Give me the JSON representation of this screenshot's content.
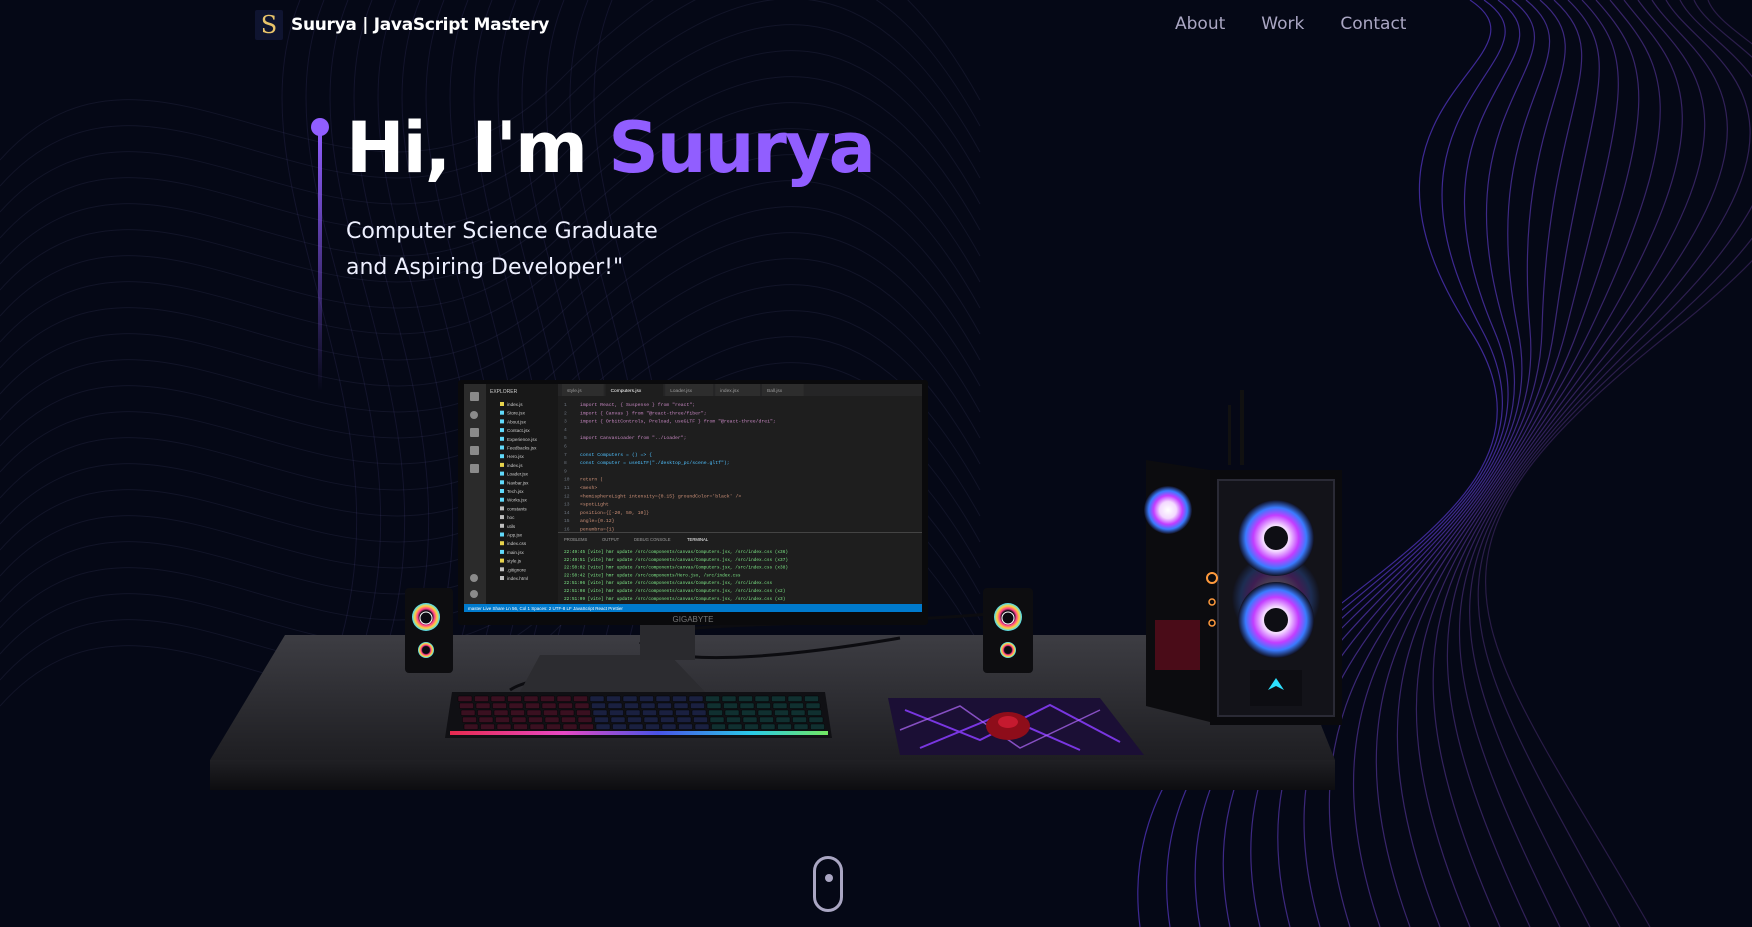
{
  "nav": {
    "logo_letter": "S",
    "brand_text": "Suurya  | JavaScript Mastery",
    "links": [
      "About",
      "Work",
      "Contact"
    ]
  },
  "hero": {
    "greeting": "Hi, I'm ",
    "name": "Suurya",
    "subtitle_line1": "Computer Science Graduate",
    "subtitle_line2": "and Aspiring Developer!\""
  },
  "monitor": {
    "brand": "GIGABYTE",
    "explorer_header": "EXPLORER",
    "tabs": [
      "style.js",
      "Computers.jsx",
      "Loader.jsx",
      "index.jsx",
      "Ball.jsx"
    ],
    "code_lines": [
      "import React, { Suspense } from \"react\";",
      "import { Canvas } from \"@react-three/fiber\";",
      "import { OrbitControls, Preload, useGLTF } from \"@react-three/drei\";",
      "",
      "import CanvasLoader from \"../Loader\";",
      "",
      "const Computers = () => {",
      "  const computer = useGLTF(\"./desktop_pc/scene.gltf\");",
      "",
      "  return (",
      "    <mesh>",
      "      <hemisphereLight intensity={0.15} groundColor='black' />",
      "      <spotLight",
      "        position={[-20, 50, 10]}",
      "        angle={0.12}",
      "        penumbra={1}"
    ],
    "files": [
      "index.js",
      "Store.jsx",
      "About.jsx",
      "Contact.jsx",
      "Experience.jsx",
      "Feedbacks.jsx",
      "Hero.jsx",
      "index.js",
      "Loader.jsx",
      "Navbar.jsx",
      "Tech.jsx",
      "Works.jsx",
      "constants",
      "hoc",
      "utils",
      "App.jsx",
      "index.css",
      "main.jsx",
      "style.js",
      ".gitignore",
      "index.html"
    ],
    "panel_tabs": [
      "PROBLEMS",
      "OUTPUT",
      "DEBUG CONSOLE",
      "TERMINAL"
    ],
    "terminal_lines": [
      "22:49:45 [vite] hmr update /src/components/canvas/Computers.jsx, /src/index.css (x36)",
      "22:49:51 [vite] hmr update /src/components/canvas/Computers.jsx, /src/index.css (x37)",
      "22:50:02 [vite] hmr update /src/components/canvas/Computers.jsx, /src/index.css (x38)",
      "22:50:42 [vite] hmr update /src/components/Hero.jsx, /src/index.css",
      "22:51:06 [vite] hmr update /src/components/canvas/Computers.jsx, /src/index.css",
      "22:51:08 [vite] hmr update /src/components/canvas/Computers.jsx, /src/index.css (x2)",
      "22:51:09 [vite] hmr update /src/components/canvas/Computers.jsx, /src/index.css (x3)"
    ],
    "status_bar": "master  Live Share   Ln 56, Col 1  Spaces: 2  UTF-8  LF  JavaScript React  Prettier"
  },
  "colors": {
    "accent": "#915eff",
    "background": "#050816",
    "nav_link": "#aaa6c3"
  }
}
